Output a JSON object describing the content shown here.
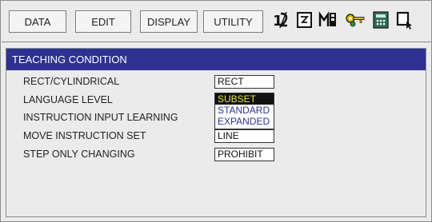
{
  "toolbar": {
    "menus": [
      {
        "label": "DATA"
      },
      {
        "label": "EDIT"
      },
      {
        "label": "DISPLAY"
      },
      {
        "label": "UTILITY"
      }
    ],
    "icons": [
      "tool-number-icon",
      "form-select-icon",
      "multi-window-icon",
      "keys-icon",
      "calculator-icon",
      "cursor-icon"
    ]
  },
  "panel": {
    "title": "TEACHING CONDITION",
    "rows": [
      {
        "label": "RECT/CYLINDRICAL",
        "value": "RECT"
      },
      {
        "label": "LANGUAGE LEVEL",
        "value": "SUBSET"
      },
      {
        "label": "INSTRUCTION INPUT LEARNING",
        "value": ""
      },
      {
        "label": "MOVE INSTRUCTION SET",
        "value": "LINE"
      },
      {
        "label": "STEP ONLY CHANGING",
        "value": "PROHIBIT"
      }
    ],
    "language_options": [
      "SUBSET",
      "STANDARD",
      "EXPANDED"
    ],
    "language_selected": "SUBSET"
  },
  "colors": {
    "title_bar": "#2e3192",
    "option_text": "#2e3192",
    "selected_bg": "#111111",
    "selected_text": "#e8e83a"
  }
}
